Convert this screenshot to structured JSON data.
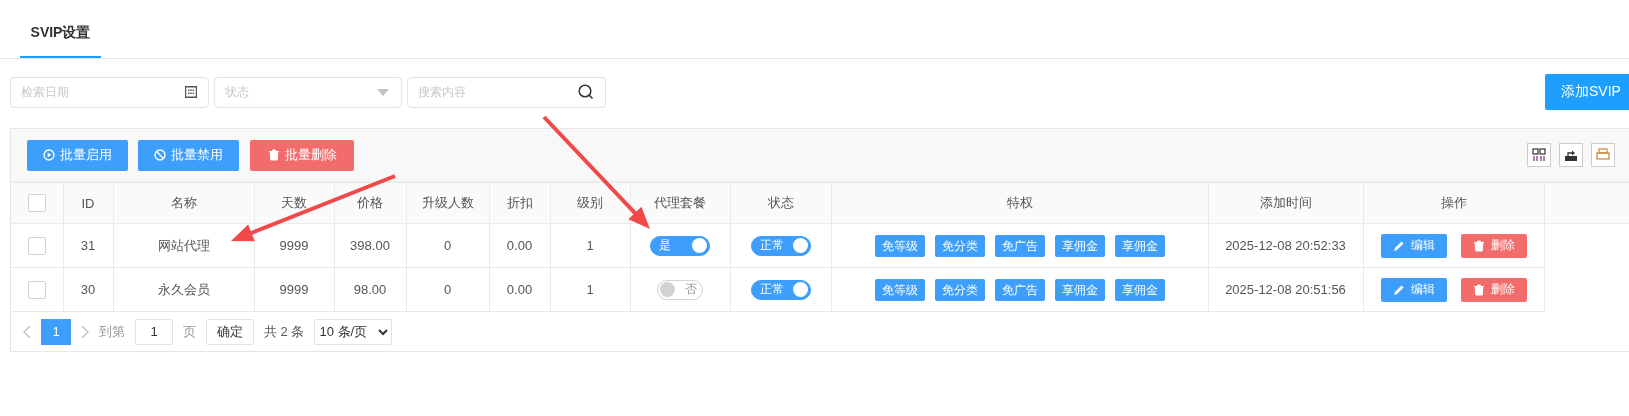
{
  "tab": {
    "label": "SVIP设置",
    "selected": true
  },
  "filters": {
    "date_placeholder": "检索日期",
    "status_placeholder": "状态",
    "search_placeholder": "搜索内容"
  },
  "add_button": {
    "label": "添加SVIP"
  },
  "batch_buttons": [
    {
      "label": "批量启用",
      "kind": "enable"
    },
    {
      "label": "批量禁用",
      "kind": "disable"
    },
    {
      "label": "批量删除",
      "kind": "delete"
    }
  ],
  "table": {
    "select_all_checked": false,
    "columns": [
      "ID",
      "名称",
      "天数",
      "价格",
      "升级人数",
      "折扣",
      "级别",
      "代理套餐",
      "状态",
      "特权",
      "添加时间",
      "操作"
    ],
    "rows": [
      {
        "checked": false,
        "cells": [
          "31",
          "网站代理",
          "9999",
          "398.00",
          "0",
          "0.00",
          "1"
        ],
        "agent": {
          "label": "是",
          "on": true
        },
        "status": {
          "label": "正常",
          "on": true
        },
        "privileges": [
          "免等级",
          "免分类",
          "免广告",
          "享佣金",
          "享佣金"
        ],
        "added": "2025-12-08 20:52:33",
        "actions": [
          {
            "label": "编辑",
            "kind": "edit"
          },
          {
            "label": "删除",
            "kind": "delete"
          }
        ]
      },
      {
        "checked": false,
        "cells": [
          "30",
          "永久会员",
          "9999",
          "98.00",
          "0",
          "0.00",
          "1"
        ],
        "agent": {
          "label": "否",
          "on": false
        },
        "status": {
          "label": "正常",
          "on": true
        },
        "privileges": [
          "免等级",
          "免分类",
          "免广告",
          "享佣金",
          "享佣金"
        ],
        "added": "2025-12-08 20:51:56",
        "actions": [
          {
            "label": "编辑",
            "kind": "edit"
          },
          {
            "label": "删除",
            "kind": "delete"
          }
        ]
      }
    ]
  },
  "pagination": {
    "pages": [
      {
        "label": "1",
        "selected": true
      }
    ],
    "goto_label": "到第",
    "page_input": "1",
    "page_unit": "页",
    "confirm": "确定",
    "total": "共 2 条",
    "page_size": "10 条/页"
  },
  "annotations": [
    {
      "kind": "arrow"
    },
    {
      "kind": "arrow"
    }
  ]
}
